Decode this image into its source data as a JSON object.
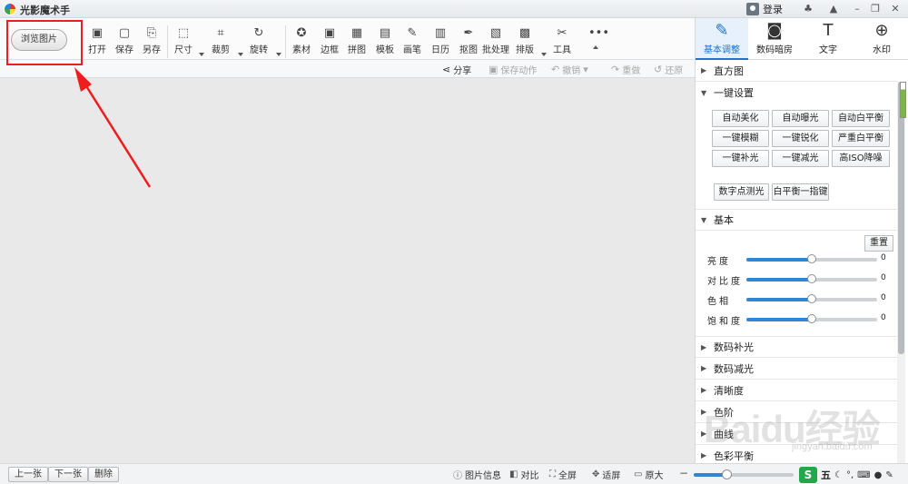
{
  "app": {
    "title": "光影魔术手",
    "login_label": "登录"
  },
  "window_controls": [
    "♣",
    "▲",
    "–",
    "❐",
    "✕"
  ],
  "toolbar": {
    "browse_label": "浏览图片",
    "tools": [
      {
        "id": "open",
        "label": "打开",
        "icon": "▣"
      },
      {
        "id": "save",
        "label": "保存",
        "icon": "▢"
      },
      {
        "id": "save-as",
        "label": "另存",
        "icon": "⎘"
      },
      {
        "id": "size",
        "label": "尺寸",
        "icon": "⬚"
      },
      {
        "id": "crop",
        "label": "裁剪",
        "icon": "⌗"
      },
      {
        "id": "rotate",
        "label": "旋转",
        "icon": "↻"
      },
      {
        "id": "material",
        "label": "素材",
        "icon": "✪"
      },
      {
        "id": "border",
        "label": "边框",
        "icon": "▣"
      },
      {
        "id": "collage",
        "label": "拼图",
        "icon": "▦"
      },
      {
        "id": "template",
        "label": "模板",
        "icon": "▤"
      },
      {
        "id": "brush",
        "label": "画笔",
        "icon": "✎"
      },
      {
        "id": "calendar",
        "label": "日历",
        "icon": "▥"
      },
      {
        "id": "cutout",
        "label": "抠图",
        "icon": "✒"
      },
      {
        "id": "batch",
        "label": "批处理",
        "icon": "▧"
      },
      {
        "id": "layout",
        "label": "排版",
        "icon": "▩"
      },
      {
        "id": "tools",
        "label": "工具",
        "icon": "✂"
      },
      {
        "id": "more",
        "label": "",
        "icon": "•••"
      }
    ]
  },
  "actionbar": {
    "share": "分享",
    "save_action": "保存动作",
    "undo": "撤销",
    "redo": "重做",
    "restore": "还原"
  },
  "panel_tabs": [
    {
      "label": "基本调整",
      "icon": "✎"
    },
    {
      "label": "数码暗房",
      "icon": "◙"
    },
    {
      "label": "文字",
      "icon": "T"
    },
    {
      "label": "水印",
      "icon": "⊕"
    }
  ],
  "panel": {
    "histogram": "直方图",
    "one_click": "一键设置",
    "presets": [
      "自动美化",
      "自动曝光",
      "自动白平衡",
      "一键模糊",
      "一键锐化",
      "严重白平衡",
      "一键补光",
      "一键减光",
      "高ISO降噪"
    ],
    "presets_extra": [
      "数字点测光",
      "白平衡一指键"
    ],
    "basic": "基本",
    "reset": "重置",
    "sliders": [
      {
        "label": "亮度",
        "value": 0
      },
      {
        "label": "对比度",
        "value": 0
      },
      {
        "label": "色相",
        "value": 0
      },
      {
        "label": "饱和度",
        "value": 0
      }
    ],
    "sections": [
      "数码补光",
      "数码减光",
      "清晰度",
      "色阶",
      "曲线",
      "色彩平衡"
    ]
  },
  "bottombar": {
    "prev": "上一张",
    "next": "下一张",
    "delete": "删除",
    "image_info": "图片信息",
    "compare": "对比",
    "fullscreen": "全屏",
    "fit": "适屏",
    "original": "原大",
    "zoom_fraction": 0.33
  },
  "ime": {
    "logo": "S",
    "char": "五"
  },
  "watermark": {
    "main": "Baidu经验",
    "sub": "jingyan.baidu.com"
  },
  "colors": {
    "accent": "#1c73c9",
    "highlight": "#ef1d1d",
    "slider": "#2f86d6"
  }
}
